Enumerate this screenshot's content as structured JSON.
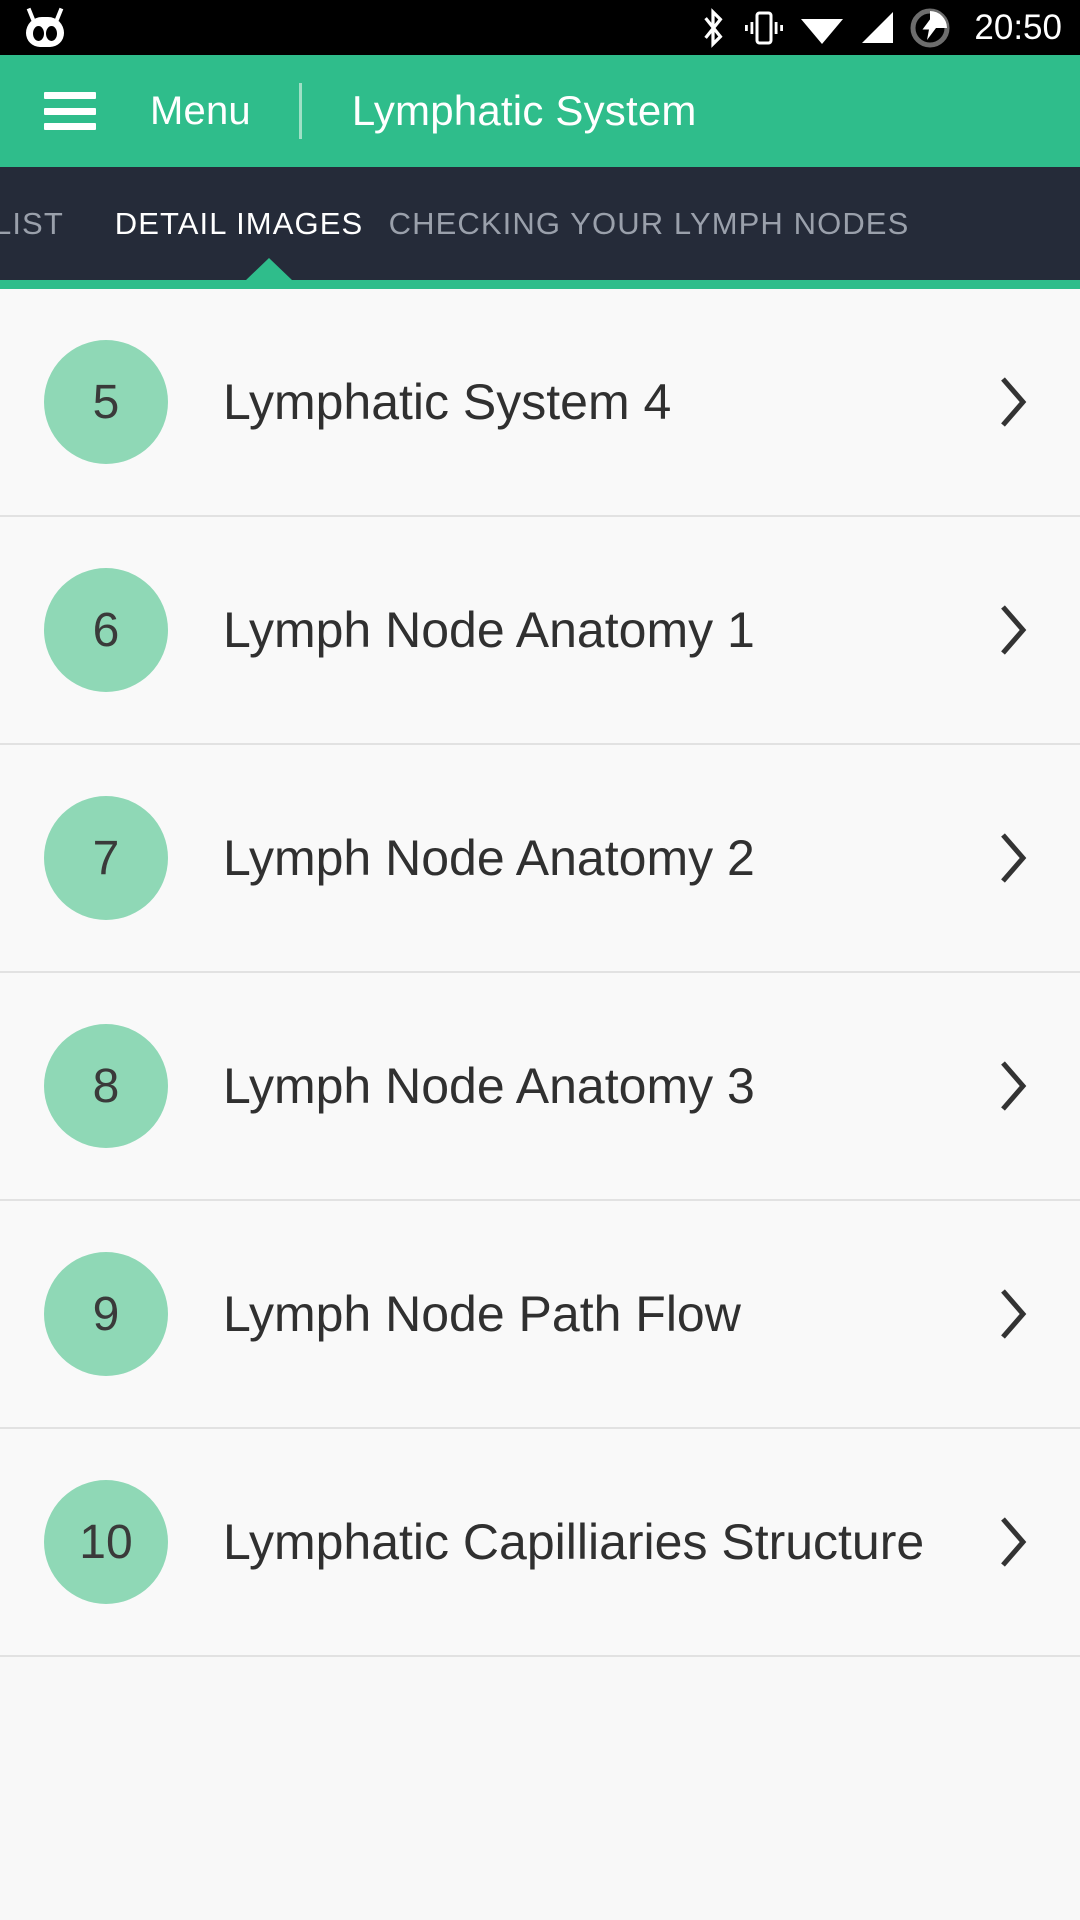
{
  "statusbar": {
    "logo": "cyanogenmod-logo",
    "icons": [
      "bluetooth-icon",
      "vibrate-icon",
      "wifi-icon",
      "cellular-signal-icon",
      "battery-charging-icon"
    ],
    "clock": "20:50"
  },
  "appbar": {
    "menu_icon": "hamburger-menu-icon",
    "menu_label": "Menu",
    "title": "Lymphatic System",
    "background_color": "#2fbd8b"
  },
  "tabs": {
    "items": [
      {
        "label": "LIST",
        "active": false
      },
      {
        "label": "DETAIL IMAGES",
        "active": true
      },
      {
        "label": "CHECKING YOUR LYMPH NODES",
        "active": false
      }
    ],
    "background_color": "#252b39",
    "indicator_color": "#2fbd8b",
    "active_color": "#ffffff",
    "inactive_color": "#9aa0ab"
  },
  "list": {
    "badge_color": "#8fd8b6",
    "chevron_icon": "chevron-right-icon",
    "rows": [
      {
        "number": "5",
        "title": "Lymphatic System 4"
      },
      {
        "number": "6",
        "title": "Lymph Node Anatomy 1"
      },
      {
        "number": "7",
        "title": "Lymph Node Anatomy 2"
      },
      {
        "number": "8",
        "title": "Lymph Node Anatomy 3"
      },
      {
        "number": "9",
        "title": "Lymph Node Path Flow"
      },
      {
        "number": "10",
        "title": "Lymphatic Capilliaries Structure"
      }
    ]
  }
}
